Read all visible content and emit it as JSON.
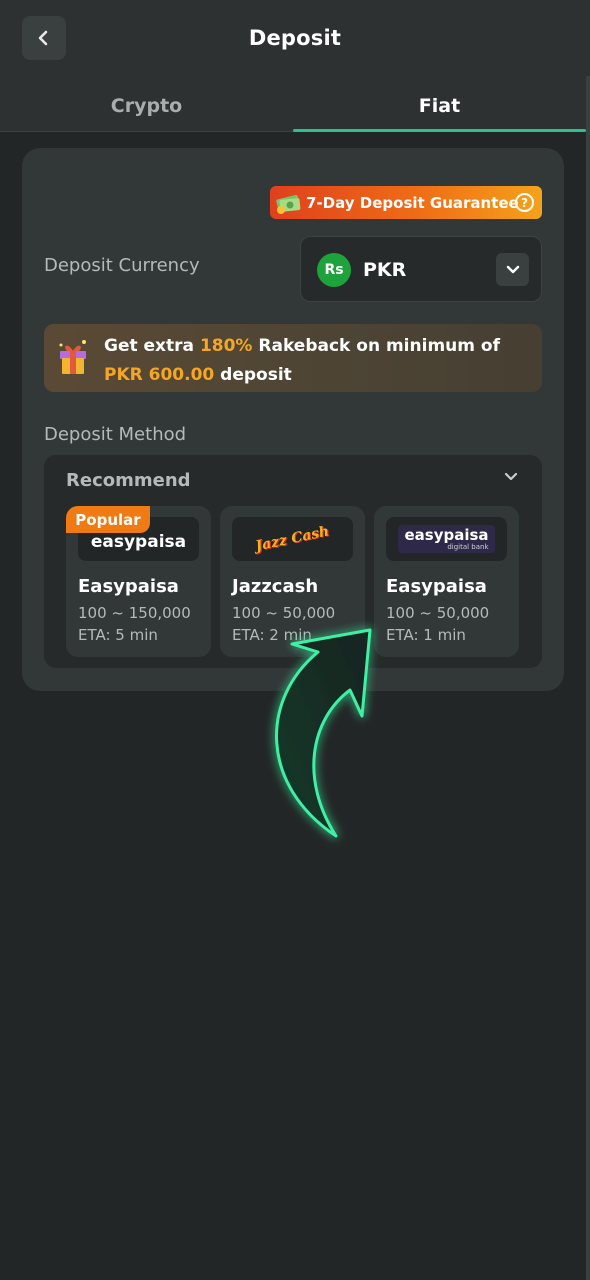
{
  "header": {
    "title": "Deposit"
  },
  "tabs": [
    {
      "label": "Crypto",
      "active": false
    },
    {
      "label": "Fiat",
      "active": true
    }
  ],
  "guarantee": {
    "label": "7-Day Deposit Guarantee",
    "help_symbol": "?"
  },
  "deposit_currency": {
    "label": "Deposit Currency",
    "symbol": "Rs",
    "code": "PKR"
  },
  "promo": {
    "text_pre": "Get extra ",
    "highlight_pct": "180%",
    "text_mid": " Rakeback on minimum of",
    "highlight_amount": "PKR 600.00",
    "text_post": " deposit"
  },
  "deposit_method": {
    "label": "Deposit Method",
    "section_title": "Recommend",
    "methods": [
      {
        "badge": "Popular",
        "logo_text": "easypaisa",
        "name": "Easypaisa",
        "range": "100 ~ 150,000",
        "eta": "ETA: 5 min"
      },
      {
        "logo_text": "Jazz Cash",
        "name": "Jazzcash",
        "range": "100 ~ 50,000",
        "eta": "ETA: 2 min"
      },
      {
        "logo_text": "easypaisa",
        "logo_subtext": "digital bank",
        "name": "Easypaisa",
        "range": "100 ~ 50,000",
        "eta": "ETA: 1 min"
      }
    ]
  },
  "colors": {
    "accent": "#27c38a",
    "highlight": "#f5a623",
    "popular": "#f07a13",
    "background": "#232626"
  },
  "icons": [
    "chevron-left-icon",
    "money-icon",
    "help-icon",
    "rupee-icon",
    "chevron-down-icon",
    "gift-icon",
    "pointer-arrow-icon"
  ]
}
